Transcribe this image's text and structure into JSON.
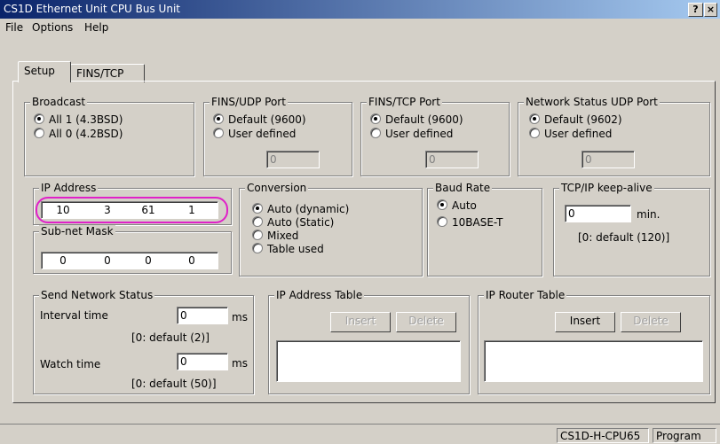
{
  "window": {
    "title": "CS1D Ethernet Unit CPU Bus Unit",
    "help_btn": "?",
    "close_btn": "×"
  },
  "menu": {
    "file": "File",
    "options": "Options",
    "help": "Help"
  },
  "tabs": {
    "setup": "Setup",
    "fins_tcp": "FINS/TCP"
  },
  "broadcast": {
    "legend": "Broadcast",
    "opt1": "All 1 (4.3BSD)",
    "opt2": "All 0 (4.2BSD)",
    "selected": "All 1 (4.3BSD)"
  },
  "fins_udp": {
    "legend": "FINS/UDP Port",
    "opt1": "Default (9600)",
    "opt2": "User defined",
    "value": "0",
    "selected": "Default (9600)"
  },
  "fins_tcp_port": {
    "legend": "FINS/TCP Port",
    "opt1": "Default (9600)",
    "opt2": "User defined",
    "value": "0",
    "selected": "Default (9600)"
  },
  "net_status_udp": {
    "legend": "Network Status UDP Port",
    "opt1": "Default (9602)",
    "opt2": "User defined",
    "value": "0",
    "selected": "Default (9602)"
  },
  "ip_address": {
    "legend": "IP Address",
    "o1": "10",
    "o2": "3",
    "o3": "61",
    "o4": "1",
    "highlight_color": "#e020c8"
  },
  "subnet": {
    "legend": "Sub-net Mask",
    "o1": "0",
    "o2": "0",
    "o3": "0",
    "o4": "0"
  },
  "conversion": {
    "legend": "Conversion",
    "opt1": "Auto (dynamic)",
    "opt2": "Auto (Static)",
    "opt3": "Mixed",
    "opt4": "Table used",
    "selected": "Auto (dynamic)"
  },
  "baud_rate": {
    "legend": "Baud Rate",
    "opt1": "Auto",
    "opt2": "10BASE-T",
    "selected": "Auto"
  },
  "keepalive": {
    "legend": "TCP/IP keep-alive",
    "value": "0",
    "unit": "min.",
    "note": "[0: default (120)]"
  },
  "send_status": {
    "legend": "Send Network Status",
    "interval_label": "Interval time",
    "interval_value": "0",
    "interval_unit": "ms",
    "interval_note": "[0: default (2)]",
    "watch_label": "Watch time",
    "watch_value": "0",
    "watch_unit": "ms",
    "watch_note": "[0: default (50)]"
  },
  "ip_table": {
    "legend": "IP Address Table",
    "insert": "Insert",
    "delete": "Delete"
  },
  "router_table": {
    "legend": "IP Router Table",
    "insert": "Insert",
    "delete": "Delete"
  },
  "statusbar": {
    "model": "CS1D-H-CPU65",
    "mode": "Program"
  }
}
